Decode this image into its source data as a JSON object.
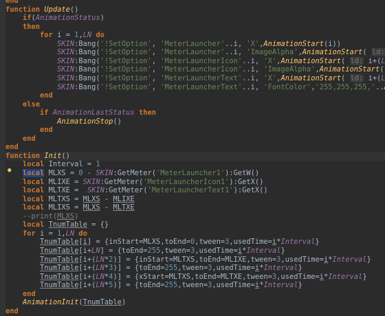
{
  "editor": {
    "language": "lua",
    "intention_icon": "lightbulb-icon",
    "current_line_index": 18,
    "lines": [
      [
        [
          "kw",
          "end"
        ]
      ],
      [
        [
          "kw",
          "function "
        ],
        [
          "fn",
          "Update"
        ],
        [
          "id",
          "()"
        ]
      ],
      [
        [
          "id",
          "    "
        ],
        [
          "kw",
          "if"
        ],
        [
          "id",
          "("
        ],
        [
          "gl",
          "AnimationStatus"
        ],
        [
          "id",
          ")"
        ]
      ],
      [
        [
          "id",
          "    "
        ],
        [
          "kw",
          "then"
        ]
      ],
      [
        [
          "id",
          "        "
        ],
        [
          "kw",
          "for "
        ],
        [
          "id",
          "i = "
        ],
        [
          "nm",
          "1"
        ],
        [
          "id",
          ","
        ],
        [
          "gl",
          "LN"
        ],
        [
          "id",
          " "
        ],
        [
          "kw",
          "do"
        ]
      ],
      [
        [
          "id",
          "            "
        ],
        [
          "gl",
          "SKIN"
        ],
        [
          "id",
          ":Bang("
        ],
        [
          "st",
          "'!SetOption'"
        ],
        [
          "id",
          ", "
        ],
        [
          "st",
          "'MeterLauncher'"
        ],
        [
          "id",
          "..i, "
        ],
        [
          "st",
          "'X'"
        ],
        [
          "id",
          ","
        ],
        [
          "fn",
          "AnimationStart"
        ],
        [
          "id",
          "(i)"
        ],
        [
          "id",
          ")"
        ]
      ],
      [
        [
          "id",
          "            "
        ],
        [
          "gl",
          "SKIN"
        ],
        [
          "id",
          ":Bang("
        ],
        [
          "st",
          "'!SetOption'"
        ],
        [
          "id",
          ", "
        ],
        [
          "st",
          "'MeterLauncher'"
        ],
        [
          "id",
          "..i, "
        ],
        [
          "st",
          "'ImageAlpha'"
        ],
        [
          "id",
          ","
        ],
        [
          "fn",
          "AnimationStart"
        ],
        [
          "id",
          "( "
        ],
        [
          "hint",
          "ld:"
        ],
        [
          "id",
          " i+"
        ],
        [
          "gl",
          "LN"
        ],
        [
          "id",
          "))"
        ]
      ],
      [
        [
          "id",
          "            "
        ],
        [
          "gl",
          "SKIN"
        ],
        [
          "id",
          ":Bang("
        ],
        [
          "st",
          "'!SetOption'"
        ],
        [
          "id",
          ", "
        ],
        [
          "st",
          "'MeterLauncherIcon'"
        ],
        [
          "id",
          "..i, "
        ],
        [
          "st",
          "'X'"
        ],
        [
          "id",
          ","
        ],
        [
          "fn",
          "AnimationStart"
        ],
        [
          "id",
          "( "
        ],
        [
          "hint",
          "ld:"
        ],
        [
          "id",
          " i+("
        ],
        [
          "gl",
          "LN"
        ],
        [
          "id",
          "*"
        ],
        [
          "nm",
          "2"
        ],
        [
          "id",
          ")))"
        ]
      ],
      [
        [
          "id",
          "            "
        ],
        [
          "gl",
          "SKIN"
        ],
        [
          "id",
          ":Bang("
        ],
        [
          "st",
          "'!SetOption'"
        ],
        [
          "id",
          ", "
        ],
        [
          "st",
          "'MeterLauncherIcon'"
        ],
        [
          "id",
          "..i, "
        ],
        [
          "st",
          "'ImageAlpha'"
        ],
        [
          "id",
          ","
        ],
        [
          "fn",
          "AnimationStart"
        ],
        [
          "id",
          "( "
        ],
        [
          "hint",
          "ld:"
        ],
        [
          "id",
          " i+"
        ]
      ],
      [
        [
          "id",
          "            "
        ],
        [
          "gl",
          "SKIN"
        ],
        [
          "id",
          ":Bang("
        ],
        [
          "st",
          "'!SetOption'"
        ],
        [
          "id",
          ", "
        ],
        [
          "st",
          "'MeterLauncherText'"
        ],
        [
          "id",
          "..i, "
        ],
        [
          "st",
          "'X'"
        ],
        [
          "id",
          ","
        ],
        [
          "fn",
          "AnimationStart"
        ],
        [
          "id",
          "( "
        ],
        [
          "hint",
          "ld:"
        ],
        [
          "id",
          " i+("
        ],
        [
          "gl",
          "LN"
        ],
        [
          "id",
          "*"
        ],
        [
          "nm",
          "4"
        ],
        [
          "id",
          ")))"
        ]
      ],
      [
        [
          "id",
          "            "
        ],
        [
          "gl",
          "SKIN"
        ],
        [
          "id",
          ":Bang("
        ],
        [
          "st",
          "'!SetOption'"
        ],
        [
          "id",
          ", "
        ],
        [
          "st",
          "'MeterLauncherText'"
        ],
        [
          "id",
          "..i, "
        ],
        [
          "st",
          "'FontColor'"
        ],
        [
          "id",
          ","
        ],
        [
          "st",
          "'255,255,255,'"
        ],
        [
          "id",
          ".."
        ],
        [
          "fn",
          "Animati"
        ]
      ],
      [
        [
          "id",
          "        "
        ],
        [
          "kw",
          "end"
        ]
      ],
      [
        [
          "id",
          "    "
        ],
        [
          "kw",
          "else"
        ]
      ],
      [
        [
          "id",
          "        "
        ],
        [
          "kw",
          "if "
        ],
        [
          "gl",
          "AnimationLastStatus"
        ],
        [
          "id",
          " "
        ],
        [
          "kw",
          "then"
        ]
      ],
      [
        [
          "id",
          "            "
        ],
        [
          "fn",
          "AnimationStop"
        ],
        [
          "id",
          "()"
        ]
      ],
      [
        [
          "id",
          "        "
        ],
        [
          "kw",
          "end"
        ]
      ],
      [
        [
          "id",
          "    "
        ],
        [
          "kw",
          "end"
        ]
      ],
      [
        [
          "kw",
          "end"
        ]
      ],
      [
        [
          "kw",
          "function "
        ],
        [
          "fn",
          "Init"
        ],
        [
          "id",
          "()"
        ]
      ],
      [
        [
          "id",
          "    "
        ],
        [
          "kw",
          "local "
        ],
        [
          "id",
          "Interval = "
        ],
        [
          "nm",
          "1"
        ]
      ],
      [
        [
          "id",
          "    "
        ],
        [
          "kwhl",
          "local"
        ],
        [
          "id",
          " MLXS = "
        ],
        [
          "nm",
          "0"
        ],
        [
          "id",
          " - "
        ],
        [
          "gl",
          "SKIN"
        ],
        [
          "id",
          ":GetMeter("
        ],
        [
          "st",
          "'MeterLauncher1'"
        ],
        [
          "id",
          "):GetW()"
        ]
      ],
      [
        [
          "id",
          "    "
        ],
        [
          "kw",
          "local "
        ],
        [
          "id",
          "MLIXE = "
        ],
        [
          "gl",
          "SKIN"
        ],
        [
          "id",
          ":GetMeter("
        ],
        [
          "st",
          "'MeterLauncherIcon1'"
        ],
        [
          "id",
          "):GetX()"
        ]
      ],
      [
        [
          "id",
          "    "
        ],
        [
          "kw",
          "local "
        ],
        [
          "id",
          "MLTXE =  "
        ],
        [
          "gl",
          "SKIN"
        ],
        [
          "id",
          ":GetMeter("
        ],
        [
          "st",
          "'MeterLauncherText1'"
        ],
        [
          "id",
          "):GetX()"
        ]
      ],
      [
        [
          "id",
          "    "
        ],
        [
          "kw",
          "local "
        ],
        [
          "id",
          "MLTXS = "
        ],
        [
          "ul",
          "MLXS"
        ],
        [
          "id",
          " - "
        ],
        [
          "ul",
          "MLIXE"
        ]
      ],
      [
        [
          "id",
          "    "
        ],
        [
          "kw",
          "local "
        ],
        [
          "id",
          "MLIXS = "
        ],
        [
          "ul",
          "MLXS"
        ],
        [
          "id",
          " - "
        ],
        [
          "ul",
          "MLTXE"
        ]
      ],
      [
        [
          "id",
          "    "
        ],
        [
          "cm",
          "--print("
        ],
        [
          "cmul",
          "MLXS"
        ],
        [
          "cm",
          ")"
        ]
      ],
      [
        [
          "id",
          "    "
        ],
        [
          "kw",
          "local "
        ],
        [
          "ul",
          "TnumTable"
        ],
        [
          "id",
          " = {}"
        ]
      ],
      [
        [
          "id",
          "    "
        ],
        [
          "kw",
          "for "
        ],
        [
          "id",
          "i = "
        ],
        [
          "nm",
          "1"
        ],
        [
          "id",
          ","
        ],
        [
          "gl",
          "LN"
        ],
        [
          "id",
          " "
        ],
        [
          "kw",
          "do"
        ]
      ],
      [
        [
          "id",
          "        "
        ],
        [
          "ul",
          "TnumTable"
        ],
        [
          "id",
          "["
        ],
        [
          "ul",
          "i"
        ],
        [
          "id",
          "] = {inStart=MLXS,toEnd="
        ],
        [
          "nm",
          "0"
        ],
        [
          "id",
          ",tween="
        ],
        [
          "nm",
          "3"
        ],
        [
          "id",
          ",usedTime="
        ],
        [
          "ul",
          "i"
        ],
        [
          "id",
          "*"
        ],
        [
          "gl",
          "Interval"
        ],
        [
          "id",
          "}"
        ]
      ],
      [
        [
          "id",
          "        "
        ],
        [
          "ul",
          "TnumTable"
        ],
        [
          "id",
          "[i+"
        ],
        [
          "gl",
          "LN"
        ],
        [
          "id",
          "] = {toEnd="
        ],
        [
          "nm",
          "255"
        ],
        [
          "id",
          ",tween="
        ],
        [
          "nm",
          "3"
        ],
        [
          "id",
          ",usedTime="
        ],
        [
          "ul",
          "i"
        ],
        [
          "id",
          "*"
        ],
        [
          "gl",
          "Interval"
        ],
        [
          "id",
          "}"
        ]
      ],
      [
        [
          "id",
          "        "
        ],
        [
          "ul",
          "TnumTable"
        ],
        [
          "id",
          "[i+("
        ],
        [
          "gl",
          "LN"
        ],
        [
          "id",
          "*"
        ],
        [
          "nm",
          "2"
        ],
        [
          "id",
          ")] = {inStart=MLTXS,toEnd=MLIXE,tween="
        ],
        [
          "nm",
          "3"
        ],
        [
          "id",
          ",usedTime="
        ],
        [
          "ul",
          "i"
        ],
        [
          "id",
          "*"
        ],
        [
          "gl",
          "Interval"
        ],
        [
          "id",
          "}"
        ]
      ],
      [
        [
          "id",
          "        "
        ],
        [
          "ul",
          "TnumTable"
        ],
        [
          "id",
          "[i+("
        ],
        [
          "gl",
          "LN"
        ],
        [
          "id",
          "*"
        ],
        [
          "nm",
          "3"
        ],
        [
          "id",
          ")] = {toEnd="
        ],
        [
          "nm",
          "255"
        ],
        [
          "id",
          ",tween="
        ],
        [
          "nm",
          "3"
        ],
        [
          "id",
          ",usedTime="
        ],
        [
          "ul",
          "i"
        ],
        [
          "id",
          "*"
        ],
        [
          "gl",
          "Interval"
        ],
        [
          "id",
          "}"
        ]
      ],
      [
        [
          "id",
          "        "
        ],
        [
          "ul",
          "TnumTable"
        ],
        [
          "id",
          "[i+("
        ],
        [
          "gl",
          "LN"
        ],
        [
          "id",
          "*"
        ],
        [
          "nm",
          "4"
        ],
        [
          "id",
          ")] = {xStart=MLTXS,toEnd=MLTXE,tween="
        ],
        [
          "nm",
          "3"
        ],
        [
          "id",
          ",usedTime="
        ],
        [
          "ul",
          "i"
        ],
        [
          "id",
          "*"
        ],
        [
          "gl",
          "Interval"
        ],
        [
          "id",
          "}"
        ]
      ],
      [
        [
          "id",
          "        "
        ],
        [
          "ul",
          "TnumTable"
        ],
        [
          "id",
          "[i+("
        ],
        [
          "gl",
          "LN"
        ],
        [
          "id",
          "*"
        ],
        [
          "nm",
          "5"
        ],
        [
          "id",
          ")] = {toEnd="
        ],
        [
          "nm",
          "255"
        ],
        [
          "id",
          ",tween="
        ],
        [
          "nm",
          "3"
        ],
        [
          "id",
          ",usedTime="
        ],
        [
          "ul",
          "i"
        ],
        [
          "id",
          "*"
        ],
        [
          "gl",
          "Interval"
        ],
        [
          "id",
          "}"
        ]
      ],
      [
        [
          "id",
          "    "
        ],
        [
          "kw",
          "end"
        ]
      ],
      [
        [
          "id",
          "    "
        ],
        [
          "fn",
          "AnimationInit"
        ],
        [
          "id",
          "("
        ],
        [
          "ul",
          "TnumTable"
        ],
        [
          "id",
          ")"
        ]
      ],
      [
        [
          "kw",
          "end"
        ]
      ]
    ]
  }
}
